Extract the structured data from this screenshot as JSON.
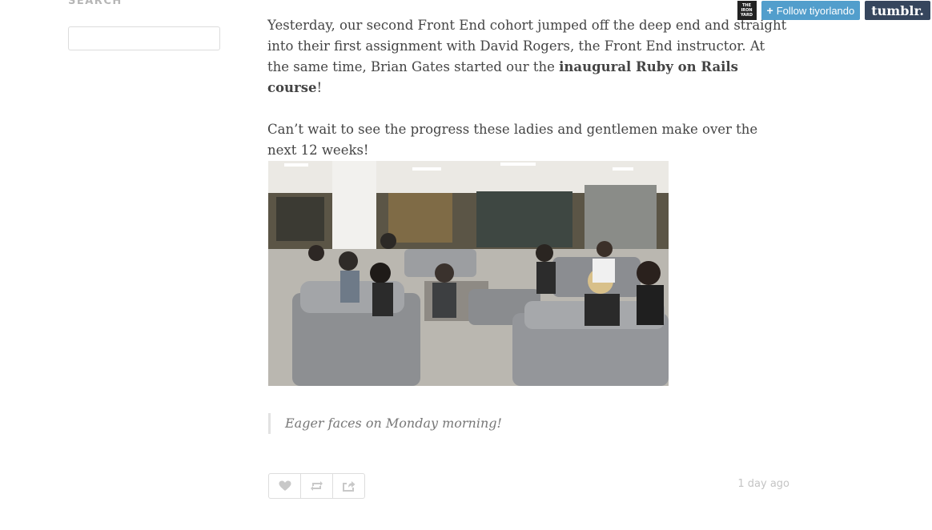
{
  "sidebar": {
    "search_label": "SEARCH",
    "search_placeholder": ""
  },
  "post": {
    "paragraph1_before": "Yesterday, our second Front End cohort jumped off the deep end and straight into their first assignment with David Rogers, the Front End instructor. At the same time, Brian Gates started our the ",
    "paragraph1_link": "inaugural Ruby on Rails course",
    "paragraph1_after": "!",
    "paragraph2": "Can’t wait to see the progress these ladies and gentlemen make over the next 12 weeks!",
    "caption": "Eager faces on Monday morning!",
    "timestamp": "1 day ago",
    "actions": {
      "like_icon": "heart-icon",
      "reblog_icon": "reblog-icon",
      "share_icon": "share-icon"
    }
  },
  "tumblr_bar": {
    "avatar_text_line1": "THE",
    "avatar_text_line2": "IRON",
    "avatar_text_line3": "YARD",
    "follow_plus": "+",
    "follow_label": "Follow tiyorlando",
    "logo": "tumblr."
  },
  "colors": {
    "follow_button": "#529ecc",
    "tumblr_logo_bg": "#36465d",
    "body_text": "#444444",
    "muted_text": "#c4c4c4"
  }
}
